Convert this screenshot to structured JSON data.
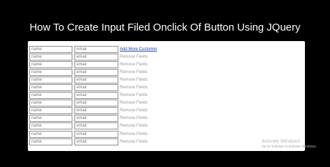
{
  "page": {
    "title": "How To Create Input Filed Onclick Of Button Using JQuery"
  },
  "form": {
    "rows": [
      {
        "name_placeholder": "name",
        "email_placeholder": "email",
        "action": "Add More Customer"
      },
      {
        "name_placeholder": "name",
        "email_placeholder": "email",
        "action": "Remove Fields"
      },
      {
        "name_placeholder": "name",
        "email_placeholder": "email",
        "action": "Remove Fields"
      },
      {
        "name_placeholder": "name",
        "email_placeholder": "email",
        "action": "Remove Fields"
      },
      {
        "name_placeholder": "name",
        "email_placeholder": "email",
        "action": "Remove Fields"
      },
      {
        "name_placeholder": "name",
        "email_placeholder": "email",
        "action": "Remove Fields"
      },
      {
        "name_placeholder": "name",
        "email_placeholder": "email",
        "action": "Remove Fields"
      },
      {
        "name_placeholder": "name",
        "email_placeholder": "email",
        "action": "Remove Fields"
      },
      {
        "name_placeholder": "name",
        "email_placeholder": "email",
        "action": "Remove Fields"
      },
      {
        "name_placeholder": "name",
        "email_placeholder": "email",
        "action": "Remove Fields"
      },
      {
        "name_placeholder": "name",
        "email_placeholder": "email",
        "action": "Remove Fields"
      },
      {
        "name_placeholder": "name",
        "email_placeholder": "email",
        "action": "Remove Fields"
      },
      {
        "name_placeholder": "name",
        "email_placeholder": "email",
        "action": "Remove Fields"
      }
    ]
  },
  "watermark": {
    "title": "Activate Windows",
    "subtitle": "Go to Settings to activate Windows."
  }
}
